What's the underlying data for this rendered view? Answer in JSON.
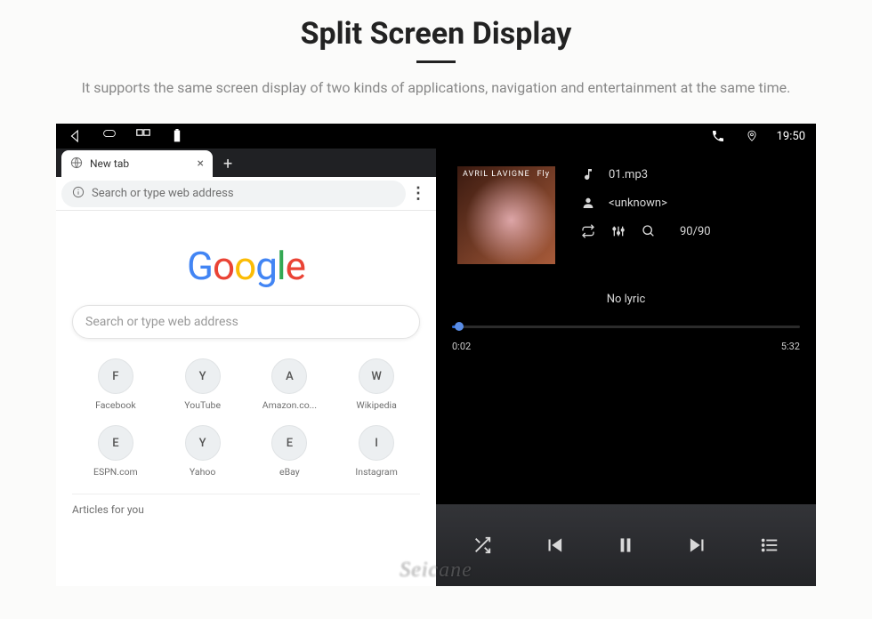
{
  "hero": {
    "title": "Split Screen Display",
    "subtitle": "It supports the same screen display of two kinds of applications, navigation and entertainment at the same time."
  },
  "statusbar": {
    "time": "19:50"
  },
  "browser": {
    "tab_title": "New tab",
    "omni_placeholder": "Search or type web address",
    "search_placeholder": "Search or type web address",
    "sites": [
      {
        "letter": "F",
        "label": "Facebook"
      },
      {
        "letter": "Y",
        "label": "YouTube"
      },
      {
        "letter": "A",
        "label": "Amazon.co..."
      },
      {
        "letter": "W",
        "label": "Wikipedia"
      },
      {
        "letter": "E",
        "label": "ESPN.com"
      },
      {
        "letter": "Y",
        "label": "Yahoo"
      },
      {
        "letter": "E",
        "label": "eBay"
      },
      {
        "letter": "I",
        "label": "Instagram"
      }
    ],
    "articles_heading": "Articles for you"
  },
  "player": {
    "track_file": "01.mp3",
    "artist": "<unknown>",
    "position_label": "90/90",
    "no_lyric": "No lyric",
    "elapsed": "0:02",
    "duration": "5:32",
    "album_top_left": "AVRIL LAVIGNE",
    "album_top_right": "Fly"
  },
  "watermark": "Seicane"
}
